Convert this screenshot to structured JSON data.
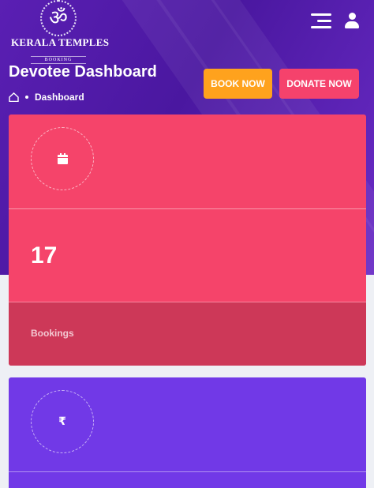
{
  "brand": {
    "emblem_glyph": "ॐ",
    "name": "KERALA TEMPLES",
    "tagline": "BOOKING"
  },
  "header": {
    "menu_icon": "menu-lines-icon",
    "user_icon": "user-icon"
  },
  "page": {
    "title": "Devotee Dashboard",
    "breadcrumb": {
      "home_icon": "home-icon",
      "current": "Dashboard"
    }
  },
  "actions": {
    "book_label": "BOOK NOW",
    "donate_label": "DONATE NOW"
  },
  "cards": [
    {
      "icon": "calendar-icon",
      "value": "17",
      "label": "Bookings",
      "color": "#f5446a"
    },
    {
      "icon": "rupee-icon",
      "icon_glyph": "₹",
      "color": "#7139e7"
    }
  ],
  "colors": {
    "hero": "#5a1fb3",
    "book_button": "#ffa21d",
    "donate_button": "#f5426c",
    "background": "#eef0f5"
  }
}
